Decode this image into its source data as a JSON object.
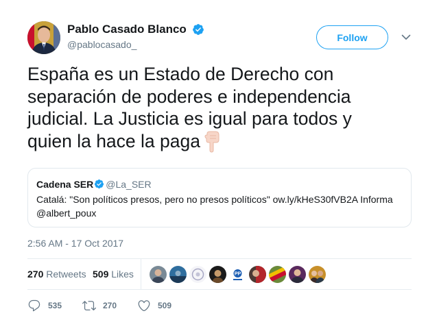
{
  "author": {
    "display_name": "Pablo Casado Blanco",
    "handle": "@pablocasado_"
  },
  "follow_label": "Follow",
  "tweet_text": "España es un Estado de Derecho con separación de poderes e independencia judicial. La Justicia es igual para todos y quien la hace la paga",
  "emoji": "pointing-down-hand",
  "quote": {
    "name": "Cadena SER",
    "handle": "@La_SER",
    "text": "Catalá: \"Son políticos presos, pero no presos políticos\" ow.ly/kHeS30fVB2A Informa @albert_poux"
  },
  "timestamp": "2:56 AM - 17 Oct 2017",
  "stats": {
    "retweets_count": "270",
    "retweets_label": "Retweets",
    "likes_count": "509",
    "likes_label": "Likes"
  },
  "actions": {
    "reply_count": "535",
    "retweet_count": "270",
    "like_count": "509"
  },
  "colors": {
    "accent": "#1da1f2",
    "secondary_text": "#657786",
    "border": "#e6ecf0"
  }
}
